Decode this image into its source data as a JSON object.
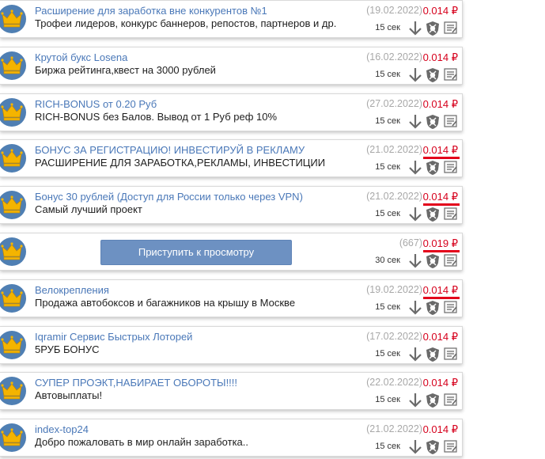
{
  "currency": "₽",
  "start_button_label": "Приступить к просмотру",
  "colors": {
    "title": "#4a78b8",
    "price": "#d6001c",
    "date": "#a8a8a8",
    "crown_bg": "#4f7fb3",
    "crown": "#f4b400",
    "button": "#6d91c2",
    "underline": "#e3001b"
  },
  "icons": [
    "crown-icon",
    "arrow-down-icon",
    "shield-icon",
    "report-icon"
  ],
  "tasks": [
    {
      "title": "Расширение для заработка вне конкурентов №1",
      "description": "Трофеи лидеров, конкурс баннеров, репостов, партнеров и др.",
      "date": "(19.02.2022)",
      "price": "0.014 ₽",
      "time": "15 сек",
      "underlined": false
    },
    {
      "title": "Крутой букс Losena",
      "description": "Биржа рейтинга,квест на 3000 рублей",
      "date": "(16.02.2022)",
      "price": "0.014 ₽",
      "time": "15 сек",
      "underlined": false
    },
    {
      "title": "RICH-BONUS от 0.20 Руб",
      "description": "RICH-BONUS без Балов. Вывод от 1 Руб реф 10%",
      "date": "(27.02.2022)",
      "price": "0.014 ₽",
      "time": "15 сек",
      "underlined": false
    },
    {
      "title": "БОНУС ЗА РЕГИСТРАЦИЮ! ИНВЕСТИРУЙ В РЕКЛАМУ",
      "description": "РАСШИРЕНИЕ ДЛЯ ЗАРАБОТКА,РЕКЛАМЫ, ИНВЕСТИЦИИ",
      "date": "(21.02.2022)",
      "price": "0.014 ₽",
      "time": "15 сек",
      "underlined": true
    },
    {
      "title": "Бонус 30 рублей (Доступ для России только через VPN)",
      "description": "Самый лучший проект",
      "date": "(21.02.2022)",
      "price": "0.014 ₽",
      "time": "15 сек",
      "underlined": true
    },
    {
      "title": "",
      "description": "",
      "date": "(667)",
      "price": "0.019 ₽",
      "time": "30 сек",
      "underlined": true,
      "is_button": true
    },
    {
      "title": "Велокрепления",
      "description": "Продажа автобоксов и багажников на крышу в Москве",
      "date": "(19.02.2022)",
      "price": "0.014 ₽",
      "time": "15 сек",
      "underlined": true
    },
    {
      "title": "Iqramir Сервис Быстрых Лоторей",
      "description": "5РУБ БОНУС",
      "date": "(17.02.2022)",
      "price": "0.014 ₽",
      "time": "15 сек",
      "underlined": false
    },
    {
      "title": "СУПЕР ПРОЭКТ,НАБИРАЕТ ОБОРОТЫ!!!!",
      "description": "Автовыплаты!",
      "date": "(22.02.2022)",
      "price": "0.014 ₽",
      "time": "15 сек",
      "underlined": false
    },
    {
      "title": "index-top24",
      "description": "Добро пожаловать в мир онлайн заработка..",
      "date": "(21.02.2022)",
      "price": "0.014 ₽",
      "time": "15 сек",
      "underlined": false
    }
  ]
}
